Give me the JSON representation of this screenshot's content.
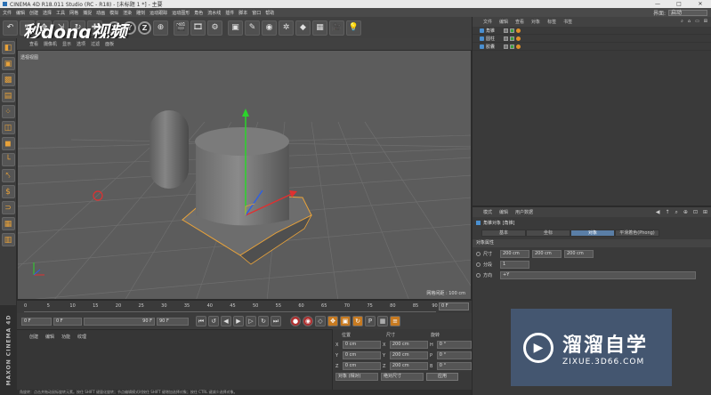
{
  "window": {
    "title": "CINEMA 4D R18.011 Studio (RC - R18) - [未标题 1 *] - 主要",
    "min": "—",
    "max": "□",
    "close": "✕"
  },
  "menubar": {
    "items": [
      "文件",
      "编辑",
      "创建",
      "选择",
      "工具",
      "网格",
      "捕捉",
      "动画",
      "模拟",
      "渲染",
      "雕刻",
      "运动跟踪",
      "运动图形",
      "角色",
      "流水线",
      "插件",
      "脚本",
      "窗口",
      "帮助"
    ],
    "layout_label": "界面:",
    "layout_value": "启动"
  },
  "toolbar": {
    "undo": "↶",
    "x": "X",
    "y": "Y",
    "z": "Z",
    "watermark": "秒dong视频"
  },
  "viewport": {
    "menu": [
      "查看",
      "摄像机",
      "显示",
      "选项",
      "过滤",
      "面板"
    ],
    "label": "透视视图",
    "grid_label": "网格间距 : 100 cm"
  },
  "timeline": {
    "ticks": [
      "0",
      "5",
      "10",
      "15",
      "20",
      "25",
      "30",
      "35",
      "40",
      "45",
      "50",
      "55",
      "60",
      "65",
      "70",
      "75",
      "80",
      "85",
      "90"
    ],
    "frame": "0 F"
  },
  "playbar": {
    "start": "0 F",
    "range_start": "0 F",
    "range_end": "90 F",
    "end": "90 F"
  },
  "material": {
    "menu": [
      "创建",
      "编辑",
      "功能",
      "纹理"
    ]
  },
  "cinema_logo": "MAXON CINEMA 4D",
  "coords": {
    "headers": [
      "位置",
      "尺寸",
      "旋转"
    ],
    "rows": [
      {
        "axis": "X",
        "pos": "0 cm",
        "size_axis": "X",
        "size": "200 cm",
        "rot_axis": "H",
        "rot": "0 °"
      },
      {
        "axis": "Y",
        "pos": "0 cm",
        "size_axis": "Y",
        "size": "200 cm",
        "rot_axis": "P",
        "rot": "0 °"
      },
      {
        "axis": "Z",
        "pos": "0 cm",
        "size_axis": "Z",
        "size": "200 cm",
        "rot_axis": "B",
        "rot": "0 °"
      }
    ],
    "mode": "对象 (相对)",
    "size_mode": "绝对尺寸",
    "apply": "应用"
  },
  "status": "角旋转：点击并拖动鼠标旋转元素。按住 SHIFT 键量化旋转；节点编辑模式时按住 SHIFT 键增加选择对象；按住 CTRL 键减少选择对象。",
  "objects": {
    "menu": [
      "文件",
      "编辑",
      "查看",
      "对象",
      "标签",
      "书签"
    ],
    "icons": [
      "⌕",
      "⌂",
      "▭",
      "⊞"
    ],
    "items": [
      {
        "name": "角锥"
      },
      {
        "name": "圆柱"
      },
      {
        "name": "胶囊"
      }
    ]
  },
  "attributes": {
    "menu": [
      "模式",
      "编辑",
      "用户数据"
    ],
    "icons": [
      "◀",
      "↑",
      "⌕",
      "⊕",
      "⊡",
      "⊞"
    ],
    "title": "角锥对象 [角锥]",
    "tabs": [
      "基本",
      "坐标",
      "对象",
      "平滑着色(Phong)"
    ],
    "active_tab": 2,
    "section": "对象属性",
    "size_label": "尺寸",
    "size_values": [
      "200 cm",
      "200 cm",
      "200 cm"
    ],
    "seg_label": "分段",
    "seg_value": "1",
    "dir_label": "方向",
    "dir_value": "+Y"
  },
  "brand": {
    "cn": "溜溜自学",
    "en": "ZIXUE.3D66.COM"
  },
  "colors": {
    "accent": "#5a7ea6",
    "selection": "#e8a23a"
  }
}
